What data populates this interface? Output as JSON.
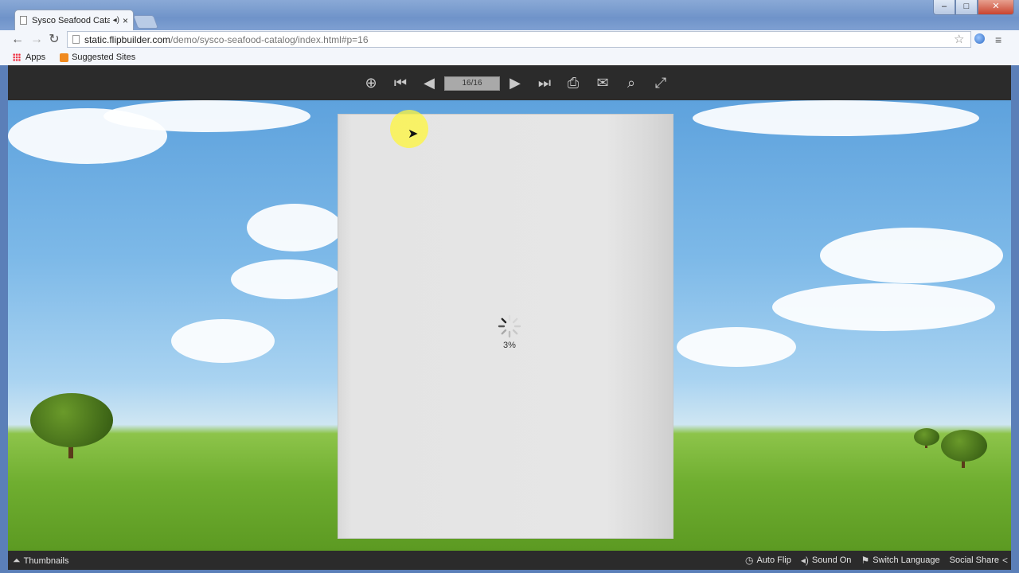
{
  "browser": {
    "tab_title": "Sysco Seafood Catalog",
    "tab_speaker_icon": "speaker-icon",
    "tab_close": "×",
    "window_controls": {
      "minimize": "‒",
      "maximize": "□",
      "close": "✕"
    },
    "nav": {
      "back": "←",
      "forward": "→",
      "reload": "↻"
    },
    "url_host": "static.flipbuilder.com",
    "url_path": "/demo/sysco-seafood-catalog/index.html#p=16",
    "star": "☆",
    "menu": "≡",
    "bookmarks": {
      "apps": "Apps",
      "suggested": "Suggested Sites"
    }
  },
  "flipbook": {
    "toolbar": {
      "zoom_in": "⊕",
      "first": "⏮",
      "prev": "◀",
      "page_indicator": "16/16",
      "next": "▶",
      "last": "⏭",
      "print": "⎙",
      "email": "✉",
      "search": "⌕",
      "fullscreen": "⤢"
    },
    "loading": {
      "percent": "3%",
      "progress": 0.03
    },
    "bottom_bar": {
      "thumbnails": "Thumbnails",
      "auto_flip": "Auto Flip",
      "sound": "Sound On",
      "switch_language": "Switch Language",
      "social_share": "Social Share"
    }
  },
  "colors": {
    "toolbar_bg": "#2b2b2b",
    "page_bg": "#e6e6e6",
    "highlight": "#fff53c"
  }
}
